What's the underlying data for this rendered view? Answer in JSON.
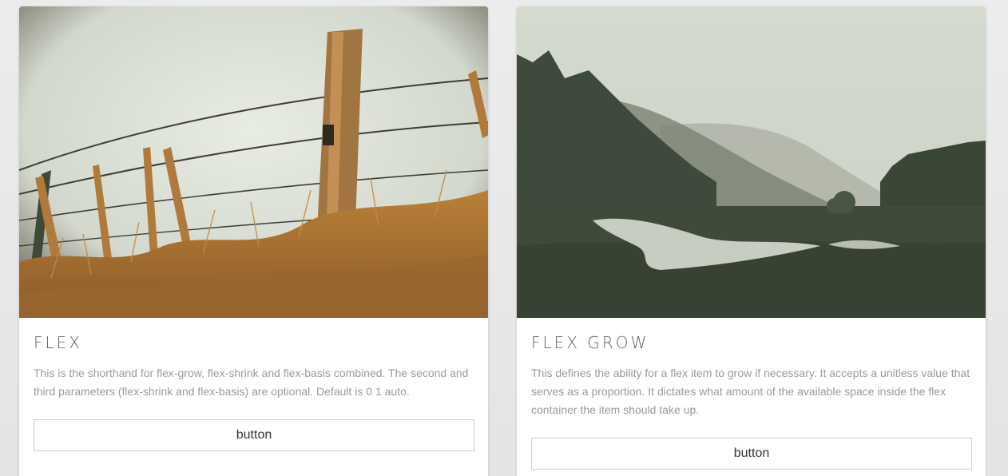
{
  "cards": [
    {
      "image": "fence-field-photo",
      "title": "FLEX",
      "text": "This is the shorthand for flex-grow, flex-shrink and flex-basis combined. The second and third parameters (flex-shrink and flex-basis) are optional. Default is 0 1 auto.",
      "button_label": "button"
    },
    {
      "image": "misty-river-valley-photo",
      "title": "FLEX GROW",
      "text": "This defines the ability for a flex item to grow if necessary. It accepts a unitless value that serves as a proportion. It dictates what amount of the available space inside the flex container the item should take up.",
      "button_label": "button"
    }
  ],
  "colors": {
    "page_background": "#e9e9e9",
    "card_background": "#ffffff",
    "title": "#5f5f5f",
    "body_text": "#9a9a9a",
    "button_border": "#cfcfcf"
  }
}
